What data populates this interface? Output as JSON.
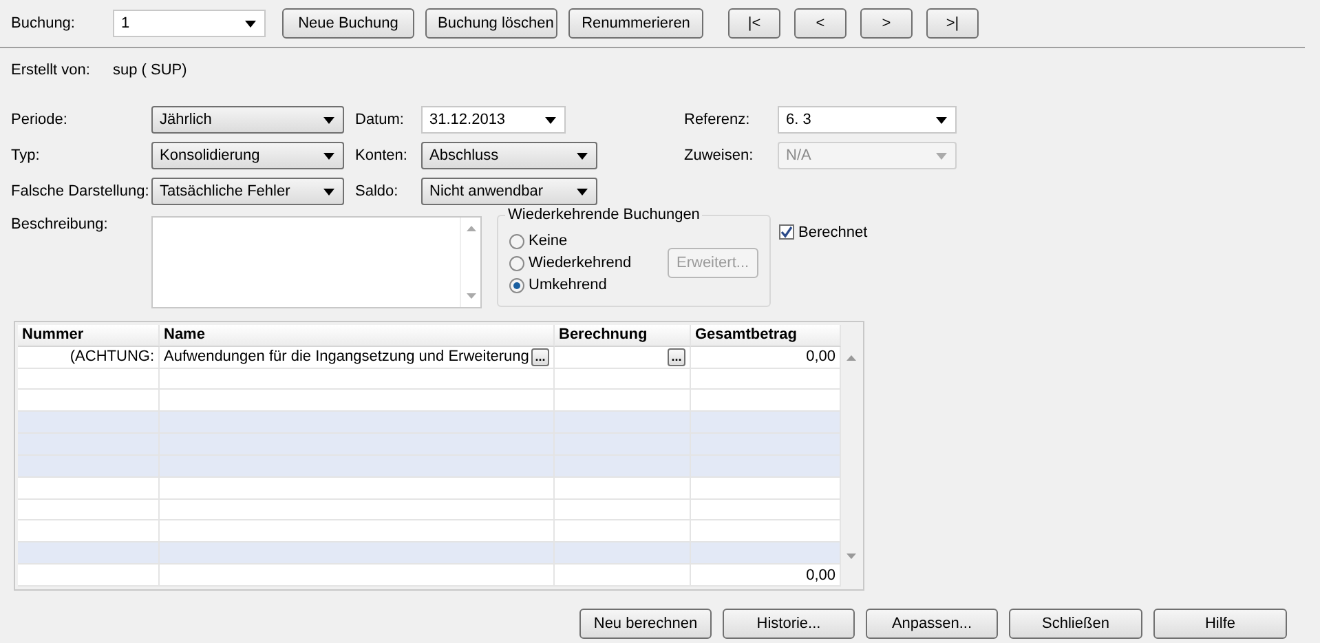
{
  "toolbar": {
    "label": "Buchung:",
    "combo": "1",
    "buttons": [
      "Neue Buchung",
      "Buchung löschen",
      "Renummerieren"
    ],
    "nav": [
      "|<",
      "<",
      ">",
      ">|"
    ]
  },
  "created": {
    "label": "Erstellt von:",
    "value": "sup ( SUP)"
  },
  "form_rows": [
    {
      "fields": [
        {
          "label": "Periode:",
          "value": "Jährlich",
          "kind": "list",
          "disabled": false
        },
        {
          "label": "Datum:",
          "value": "31.12.2013",
          "kind": "editable",
          "disabled": false
        },
        {
          "label": "Referenz:",
          "value": "6.  3",
          "kind": "editable",
          "disabled": false
        }
      ]
    },
    {
      "fields": [
        {
          "label": "Typ:",
          "value": "Konsolidierung",
          "kind": "list",
          "disabled": false
        },
        {
          "label": "Konten:",
          "value": "Abschluss",
          "kind": "list",
          "disabled": false
        },
        {
          "label": "Zuweisen:",
          "value": "N/A",
          "kind": "list",
          "disabled": true
        }
      ]
    },
    {
      "fields": [
        {
          "label": "Falsche Darstellung:",
          "value": "Tatsächliche Fehler",
          "kind": "list",
          "disabled": false
        },
        {
          "label": "Saldo:",
          "value": "Nicht anwendbar",
          "kind": "list",
          "disabled": false
        }
      ]
    }
  ],
  "description": {
    "label": "Beschreibung:"
  },
  "recurring": {
    "title": "Wiederkehrende Buchungen",
    "options": [
      {
        "label": "Keine",
        "selected": false
      },
      {
        "label": "Wiederkehrend",
        "selected": false
      },
      {
        "label": "Umkehrend",
        "selected": true
      }
    ],
    "button": {
      "label": "Erweitert...",
      "disabled": true
    }
  },
  "calculated": {
    "label": "Berechnet",
    "checked": true
  },
  "table": {
    "columns": [
      "Nummer",
      "Name",
      "Berechnung",
      "Gesamtbetrag"
    ],
    "rows": [
      {
        "nummer": "(ACHTUNG:",
        "name": "Aufwendungen für die Ingangsetzung und Erweiterung",
        "name_button": "...",
        "berechnung_button": "...",
        "gesamtbetrag": "0,00",
        "selected": false
      },
      {
        "selected": false
      },
      {
        "selected": false
      },
      {
        "selected": true
      },
      {
        "selected": true
      },
      {
        "selected": true
      },
      {
        "selected": false
      },
      {
        "selected": false
      },
      {
        "selected": false
      },
      {
        "selected": true
      }
    ],
    "total": "0,00"
  },
  "buttons": [
    "Neu berechnen",
    "Historie...",
    "Anpassen...",
    "Schließen",
    "Hilfe"
  ]
}
